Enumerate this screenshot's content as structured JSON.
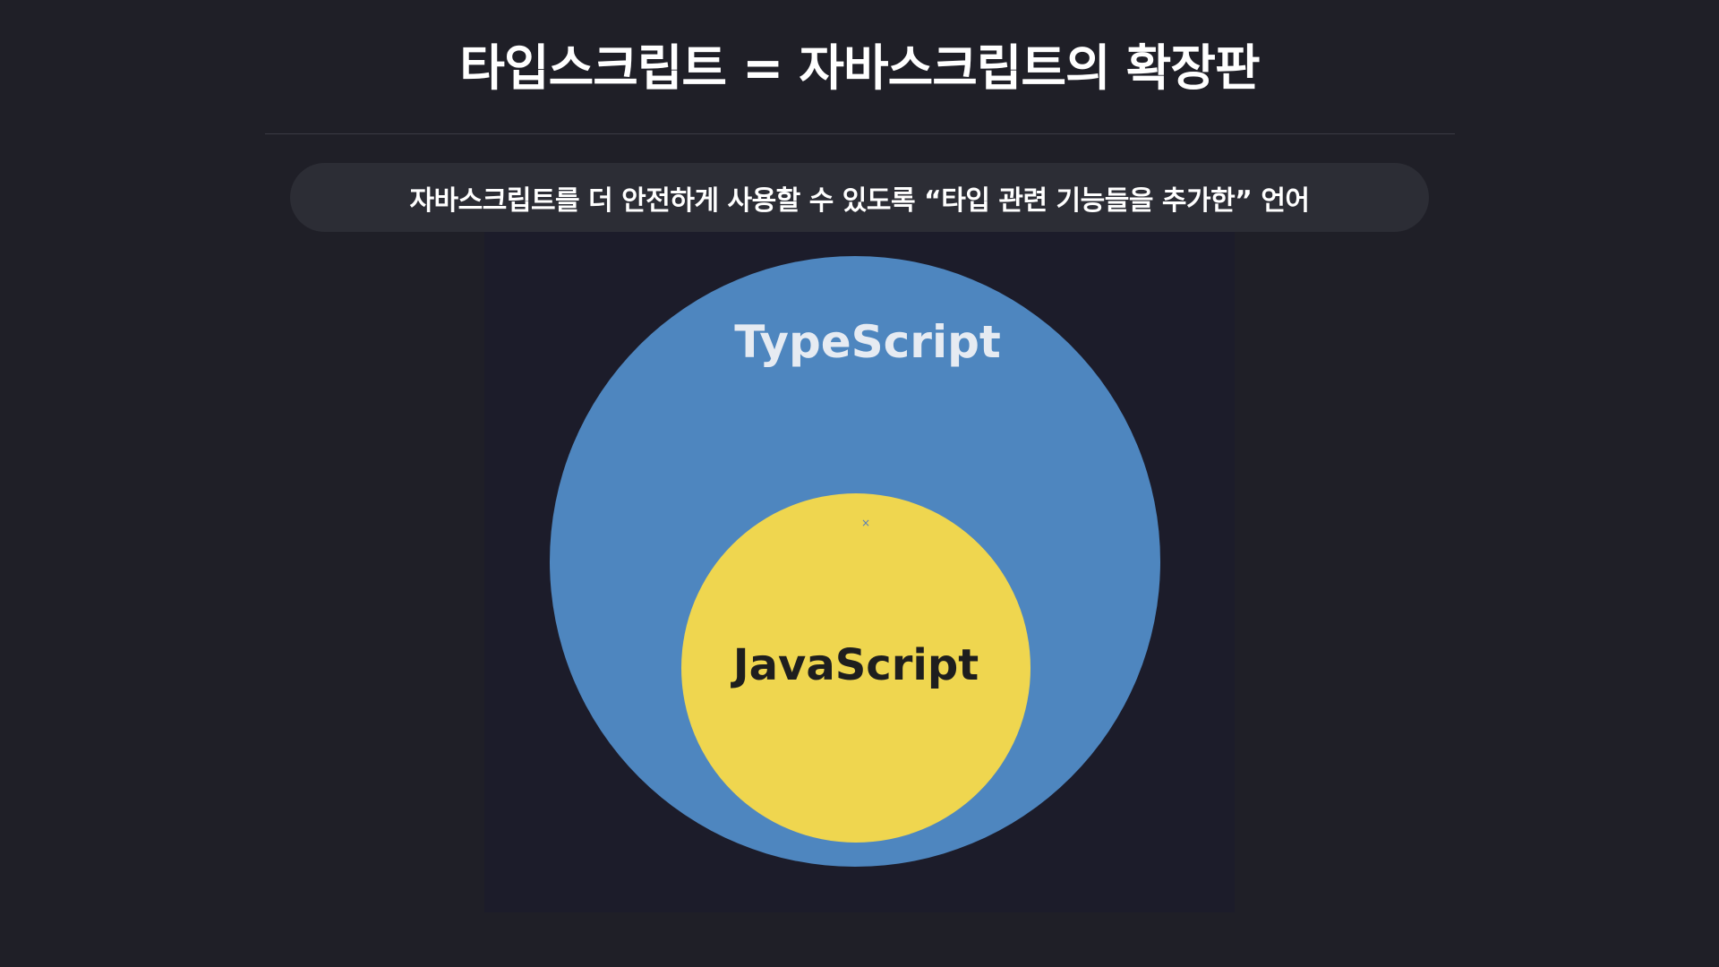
{
  "slide": {
    "title": "타입스크립트 = 자바스크립트의 확장판",
    "subtitle": "자바스크립트를 더 안전하게 사용할 수 있도록 “타입 관련 기능들을 추가한” 언어"
  },
  "diagram": {
    "outer_circle": {
      "label": "TypeScript",
      "fill": "#4e86bf",
      "label_color": "#e6ebf2"
    },
    "inner_circle": {
      "label": "JavaScript",
      "fill": "#efd64f",
      "label_color": "#1e1e1e"
    },
    "marker": "×"
  },
  "colors": {
    "background": "#1f1f27",
    "panel": "#1c1c2a",
    "pill": "#2c2d35",
    "text": "#ffffff"
  }
}
